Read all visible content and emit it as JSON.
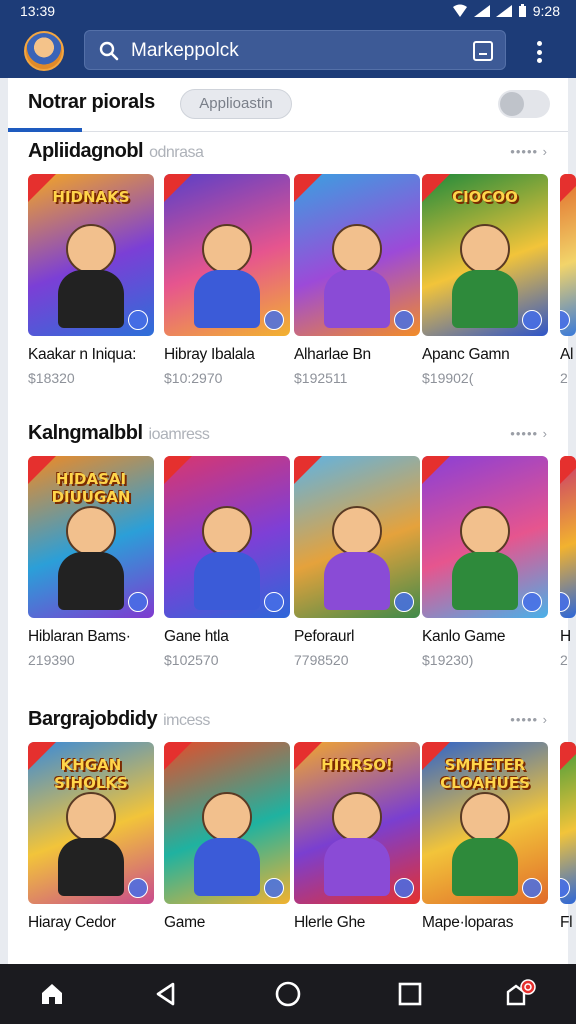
{
  "status": {
    "time": "13:39",
    "right_time": "9:28"
  },
  "search": {
    "placeholder": "Markeppolck"
  },
  "tabs": {
    "active": "Notrar piorals",
    "chip": "Applioastin"
  },
  "sections": [
    {
      "title": "Apliidagnobl",
      "subtitle": "odnrasa",
      "see_more": "••••• ›",
      "items": [
        {
          "name": "Kaakar n Iniqua:",
          "price": "$18320"
        },
        {
          "name": "Hibray Ibalala",
          "price": "$10:2970"
        },
        {
          "name": "Alharlae Bn",
          "price": "$192511"
        },
        {
          "name": "Apanc Gamn",
          "price": "$19902("
        },
        {
          "name": "Al",
          "price": "2"
        }
      ]
    },
    {
      "title": "Kalngmalbbl",
      "subtitle": "ioamress",
      "see_more": "••••• ›",
      "items": [
        {
          "name": "Hiblaran Bams·",
          "price": "219390"
        },
        {
          "name": "Gane htla",
          "price": "$102570"
        },
        {
          "name": "Peforaurl",
          "price": "7798520"
        },
        {
          "name": "Kanlo Game",
          "price": "$19230)"
        },
        {
          "name": "H",
          "price": "2"
        }
      ]
    },
    {
      "title": "Bargrajobdidy",
      "subtitle": "imcess",
      "see_more": "••••• ›",
      "items": [
        {
          "name": "Hiaray Cedor",
          "price": ""
        },
        {
          "name": "Game",
          "price": ""
        },
        {
          "name": "Hlerle Ghe",
          "price": ""
        },
        {
          "name": "Mape·loparas",
          "price": ""
        },
        {
          "name": "Fl",
          "price": ""
        }
      ]
    }
  ],
  "art_titles": [
    "HIDNAKS",
    "",
    "",
    "CIOCOO",
    "",
    "HIDASAI DIUUGAN",
    "",
    "",
    "",
    "",
    "KHGAN SIHOLKS",
    "",
    "HIRRSO!",
    "SMHETER CLOAHUES",
    ""
  ],
  "colors": {
    "header": "#1d3c78",
    "accent": "#1e5bbf",
    "nav": "#1b1b1f"
  }
}
